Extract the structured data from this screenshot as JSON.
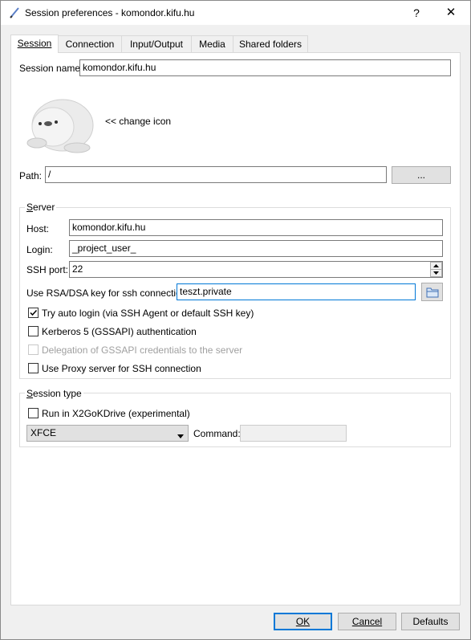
{
  "window": {
    "title": "Session preferences - komondor.kifu.hu",
    "help_label": "?",
    "close_label": "✕"
  },
  "tabs": [
    {
      "label": "Session",
      "active": true
    },
    {
      "label": "Connection"
    },
    {
      "label": "Input/Output"
    },
    {
      "label": "Media"
    },
    {
      "label": "Shared folders"
    }
  ],
  "session": {
    "name_label": "Session name:",
    "name_value": "komondor.kifu.hu",
    "change_icon_label": "<< change icon",
    "path_label": "Path:",
    "path_value": "/",
    "browse_label": "..."
  },
  "server": {
    "title": "Server",
    "host_label": "Host:",
    "host_value": "komondor.kifu.hu",
    "login_label": "Login:",
    "login_value": "_project_user_",
    "ssh_port_label": "SSH port:",
    "ssh_port_value": "22",
    "rsa_label": "Use RSA/DSA key for ssh connection:",
    "rsa_value": "teszt.private",
    "options": [
      {
        "label": "Try auto login (via SSH Agent or default SSH key)",
        "checked": true,
        "enabled": true
      },
      {
        "label": "Kerberos 5 (GSSAPI) authentication",
        "checked": false,
        "enabled": true
      },
      {
        "label": "Delegation of GSSAPI credentials to the server",
        "checked": false,
        "enabled": false
      },
      {
        "label": "Use Proxy server for SSH connection",
        "checked": false,
        "enabled": true
      }
    ]
  },
  "session_type": {
    "title": "Session type",
    "x2go_drive_label": "Run in X2GoKDrive (experimental)",
    "x2go_drive_checked": false,
    "type_value": "XFCE",
    "command_label": "Command:",
    "command_value": ""
  },
  "footer": {
    "ok_label": "OK",
    "cancel_label": "Cancel",
    "defaults_label": "Defaults"
  }
}
